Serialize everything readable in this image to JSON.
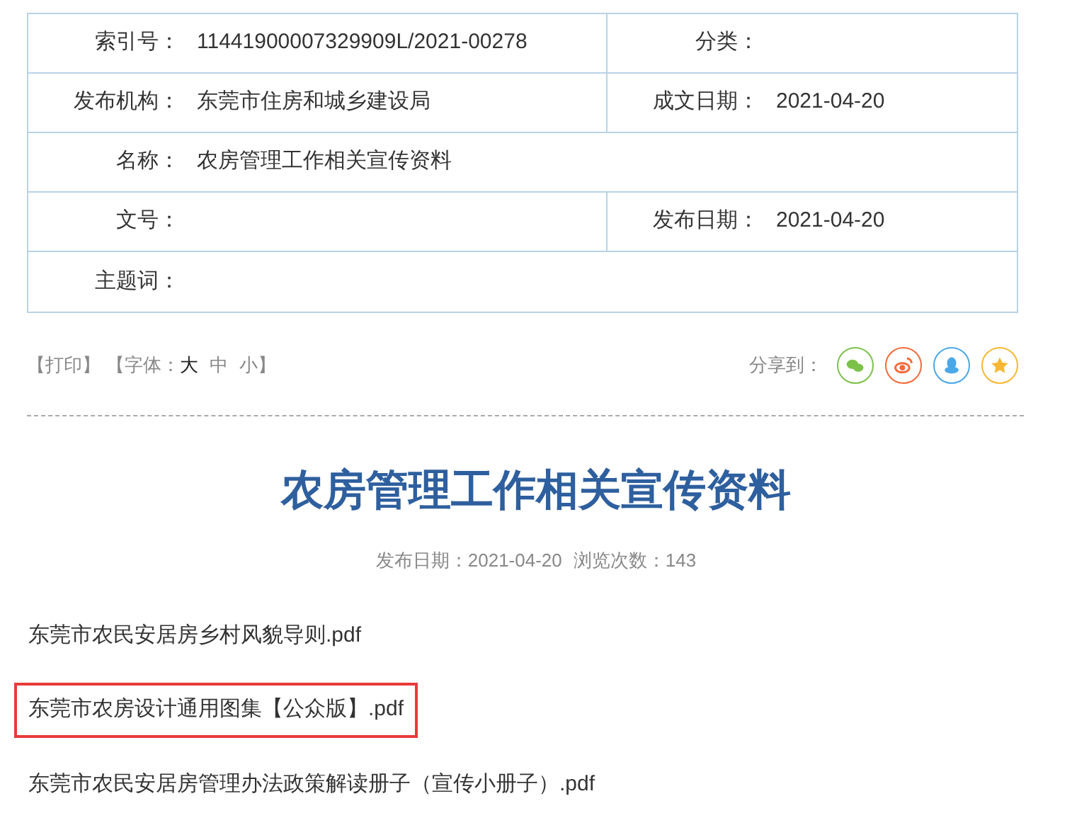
{
  "info_table": {
    "rows": [
      {
        "cells": [
          {
            "label": "索引号：",
            "value": "11441900007329909L/2021-00278"
          },
          {
            "label": "分类："
          }
        ]
      },
      {
        "cells": [
          {
            "label": "发布机构：",
            "value": "东莞市住房和城乡建设局"
          },
          {
            "label": "成文日期：",
            "value": "2021-04-20"
          }
        ]
      },
      {
        "cells": [
          {
            "label": "名称：",
            "value": "农房管理工作相关宣传资料"
          }
        ]
      },
      {
        "cells": [
          {
            "label": "文号："
          },
          {
            "label": "发布日期：",
            "value": "2021-04-20"
          }
        ]
      },
      {
        "cells": [
          {
            "label": "主题词："
          }
        ]
      }
    ]
  },
  "toolbar": {
    "print": "【打印】",
    "font_label": "【字体：",
    "font_sizes": [
      {
        "label": "大",
        "selected": true
      },
      {
        "label": "中",
        "selected": false
      },
      {
        "label": "小",
        "selected": false
      }
    ],
    "font_close": "】",
    "share_label": "分享到：",
    "share_buttons": [
      {
        "kind": "wechat"
      },
      {
        "kind": "weibo"
      },
      {
        "kind": "qq"
      },
      {
        "kind": "qzone"
      }
    ]
  },
  "article": {
    "title": "农房管理工作相关宣传资料",
    "publish_date": "发布日期：2021-04-20",
    "views": "浏览次数：143",
    "attachments": [
      {
        "name": "东莞市农民安居房乡村风貌导则.pdf",
        "highlighted": false
      },
      {
        "name": "东莞市农房设计通用图集【公众版】.pdf",
        "highlighted": true
      },
      {
        "name": "东莞市农民安居房管理办法政策解读册子（宣传小册子）.pdf",
        "highlighted": false
      }
    ]
  }
}
